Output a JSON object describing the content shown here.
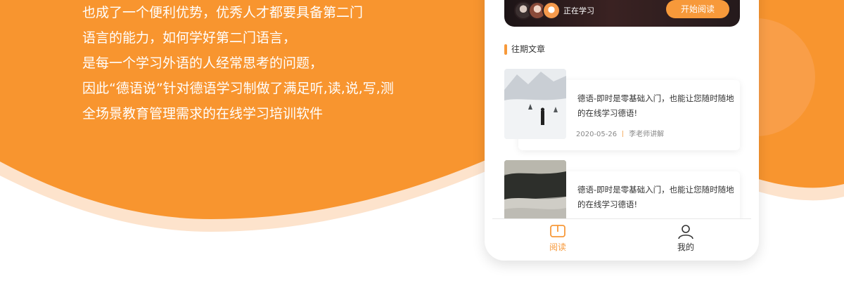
{
  "intro": {
    "lines": [
      "也成了一个便利优势，优秀人才都要具备第二门",
      "语言的能力，如何学好第二门语言，",
      "是每一个学习外语的人经常思考的问题，",
      "因此“德语说”针对德语学习制做了满足听,读,说,写,测",
      "全场景教育管理需求的在线学习培训软件"
    ]
  },
  "banner": {
    "learning_label": "正在学习",
    "start_button": "开始阅读"
  },
  "section": {
    "title": "往期文章"
  },
  "articles": [
    {
      "title": "德语-即时是零基础入门，也能让您随时随地的在线学习德语!",
      "date": "2020-05-26",
      "author": "李老师讲解"
    },
    {
      "title": "德语-即时是零基础入门，也能让您随时随地的在线学习德语!",
      "date": "",
      "author": ""
    }
  ],
  "tabbar": {
    "read": "阅读",
    "mine": "我的"
  },
  "colors": {
    "accent": "#f7993a",
    "wave_light": "#fde3cc",
    "text_dark": "#333333"
  },
  "icons": [
    "book-icon",
    "user-icon"
  ]
}
